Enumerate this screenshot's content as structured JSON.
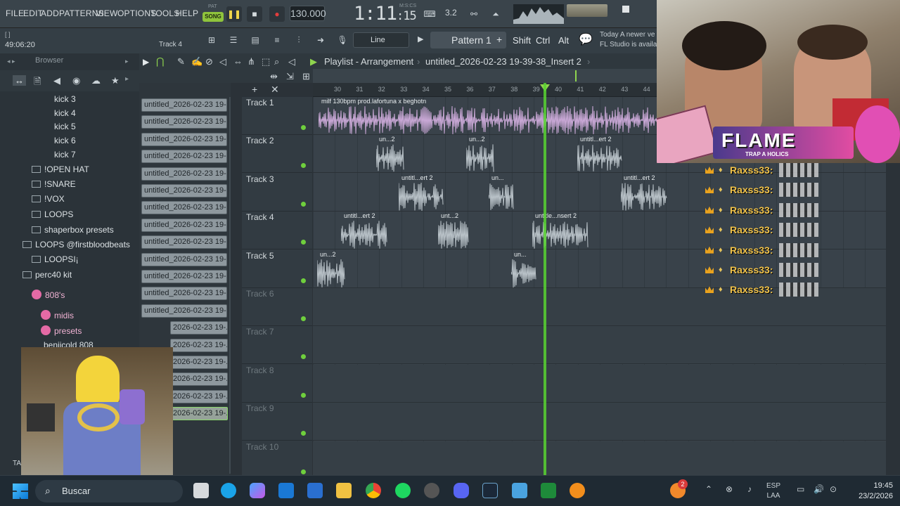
{
  "menu": [
    "FILE",
    "EDIT",
    "ADD",
    "PATTERNS",
    "VIEW",
    "OPTIONS",
    "TOOLS",
    "HELP"
  ],
  "transport": {
    "pat_label": "PAT",
    "song_label": "SONG",
    "tempo": "130.000",
    "time": "1:11",
    "time_small": ":15",
    "time_units": "M:S:CS",
    "cpu": "3.2"
  },
  "hint_text": "[ ]",
  "clock": "49:06:20",
  "hint_track": "Track 4",
  "toolbar": {
    "snap": "Line",
    "pattern": "Pattern 1",
    "shift": "Shift",
    "ctrl": "Ctrl",
    "alt": "Alt",
    "news_line1": "Today  A newer ve",
    "news_line2": "FL Studio is availa"
  },
  "browser": {
    "title": "Browser",
    "items": [
      {
        "label": "kick 3",
        "type": "file"
      },
      {
        "label": "kick 4",
        "type": "file"
      },
      {
        "label": "kick 5",
        "type": "file"
      },
      {
        "label": "kick 6",
        "type": "file"
      },
      {
        "label": "kick 7",
        "type": "file"
      },
      {
        "label": "!OPEN HAT",
        "type": "folder"
      },
      {
        "label": "!SNARE",
        "type": "folder"
      },
      {
        "label": "!VOX",
        "type": "folder"
      },
      {
        "label": "LOOPS",
        "type": "folder"
      },
      {
        "label": "shaperbox presets",
        "type": "folder"
      },
      {
        "label": "LOOPS @firstbloodbeats",
        "type": "folder"
      },
      {
        "label": "LOOPSI¡",
        "type": "folder"
      },
      {
        "label": "perc40 kit",
        "type": "folder"
      },
      {
        "label": "808's",
        "type": "pink"
      },
      {
        "label": "midis",
        "type": "pink"
      },
      {
        "label": "presets",
        "type": "pink"
      },
      {
        "label": "beniicold 808",
        "type": "file"
      }
    ]
  },
  "clips": [
    "untitled_2026-02-23 19-...",
    "untitled_2026-02-23 19-...",
    "untitled_2026-02-23 19-...",
    "untitled_2026-02-23 19-...",
    "untitled_2026-02-23 19-...",
    "untitled_2026-02-23 19-...",
    "untitled_2026-02-23 19-...",
    "untitled_2026-02-23 19-...",
    "untitled_2026-02-23 19-...",
    "untitled_2026-02-23 19-...",
    "untitled_2026-02-23 19-...",
    "untitled_2026-02-23 19-...",
    "untitled_2026-02-23 19-...",
    "2026-02-23 19-...",
    "2026-02-23 19-...",
    "2026-02-23 19-...",
    "2026-02-23 19-...",
    "2026-02-23 19-...",
    "2026-02-23 19-..."
  ],
  "playlist": {
    "title": "Playlist - Arrangement",
    "path": "untitled_2026-02-23 19-39-38_Insert 2",
    "ruler": [
      "30",
      "31",
      "32",
      "33",
      "34",
      "35",
      "36",
      "37",
      "38",
      "39",
      "40",
      "41",
      "42",
      "43",
      "44"
    ],
    "tracks": [
      "Track 1",
      "Track 2",
      "Track 3",
      "Track 4",
      "Track 5",
      "Track 6",
      "Track 7",
      "Track 8",
      "Track 9",
      "Track 10"
    ],
    "track1_clip": "milf 130bpm prod.lafortuna x beghotn",
    "labels": {
      "un2": "un...2",
      "unti2": "untitl...ert 2",
      "un": "un...",
      "unt2": "unt...2",
      "untitle": "untitle...nsert 2"
    }
  },
  "chat": {
    "user": "Raxss33:",
    "count": 7
  },
  "stream": {
    "brand": "FLAME",
    "sub": "TRAP A HOLICS"
  },
  "overlay": {
    "text": "TA"
  },
  "taskbar": {
    "search": "Buscar",
    "lang1": "ESP",
    "lang2": "LAA",
    "time": "19:45",
    "date": "23/2/2026",
    "badge": "2"
  },
  "colors": {
    "accent": "#8fc43c",
    "playhead": "#58d331",
    "clip_purple": "#c9a8d6",
    "clip_grey": "#b9c2c8"
  }
}
